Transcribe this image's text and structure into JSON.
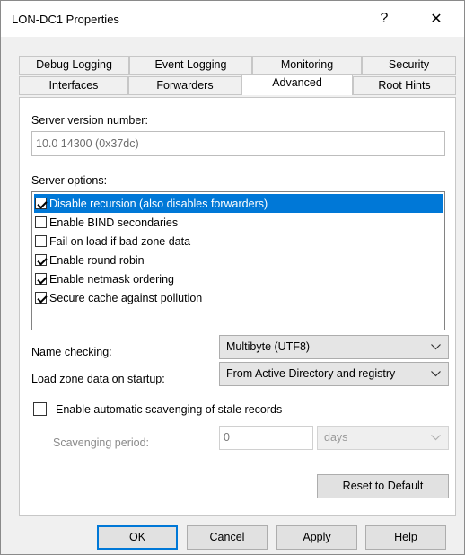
{
  "window": {
    "title": "LON-DC1 Properties",
    "help_glyph": "?",
    "close_glyph": "✕"
  },
  "tabs": {
    "row1": [
      "Debug Logging",
      "Event Logging",
      "Monitoring",
      "Security"
    ],
    "row2": [
      "Interfaces",
      "Forwarders",
      "Advanced",
      "Root Hints"
    ],
    "active": "Advanced"
  },
  "advanced": {
    "server_version_label": "Server version number:",
    "server_version_value": "10.0 14300 (0x37dc)",
    "server_options_label": "Server options:",
    "options": [
      {
        "label": "Disable recursion (also disables forwarders)",
        "checked": true,
        "selected": true
      },
      {
        "label": "Enable BIND secondaries",
        "checked": false,
        "selected": false
      },
      {
        "label": "Fail on load if bad zone data",
        "checked": false,
        "selected": false
      },
      {
        "label": "Enable round robin",
        "checked": true,
        "selected": false
      },
      {
        "label": "Enable netmask ordering",
        "checked": true,
        "selected": false
      },
      {
        "label": "Secure cache against pollution",
        "checked": true,
        "selected": false
      }
    ],
    "name_checking_label": "Name checking:",
    "name_checking_value": "Multibyte (UTF8)",
    "load_zone_label": "Load zone data on startup:",
    "load_zone_value": "From Active Directory and registry",
    "scavenging_label": "Enable automatic scavenging of stale records",
    "scavenging_checked": false,
    "scavenging_period_label": "Scavenging period:",
    "scavenging_period_value": "0",
    "scavenging_unit": "days",
    "reset_label": "Reset to Default"
  },
  "buttons": {
    "ok": "OK",
    "cancel": "Cancel",
    "apply": "Apply",
    "help": "Help"
  }
}
